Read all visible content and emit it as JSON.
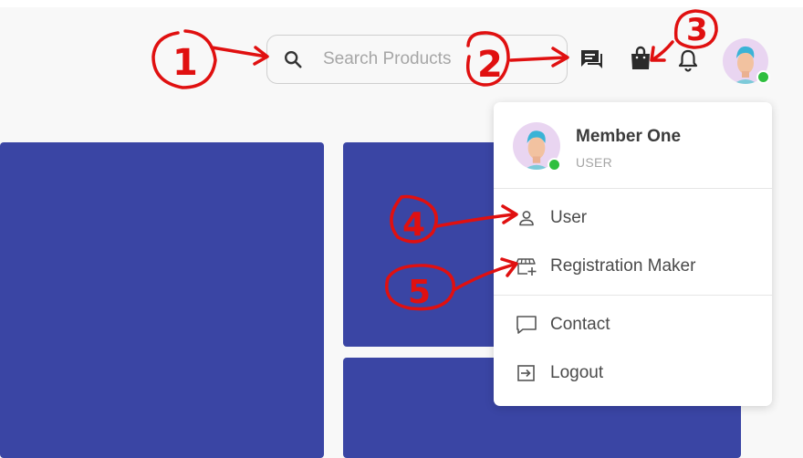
{
  "header": {
    "search": {
      "placeholder": "Search Products",
      "icon": "search-icon"
    },
    "icons": [
      "chat-icon",
      "shopping-bag-icon",
      "bell-icon"
    ],
    "avatar_status": "online"
  },
  "menu": {
    "user_name": "Member One",
    "user_role": "USER",
    "items": [
      {
        "label": "User",
        "icon": "user-icon"
      },
      {
        "label": "Registration Maker",
        "icon": "store-add-icon"
      },
      {
        "label": "Contact",
        "icon": "message-square-icon"
      },
      {
        "label": "Logout",
        "icon": "logout-icon"
      }
    ]
  },
  "annotations": [
    "1",
    "2",
    "3",
    "4",
    "5"
  ],
  "colors": {
    "tile": "#3a45a4",
    "annotation": "#e01010",
    "online": "#2fbf3f",
    "background": "#f8f8f8"
  }
}
